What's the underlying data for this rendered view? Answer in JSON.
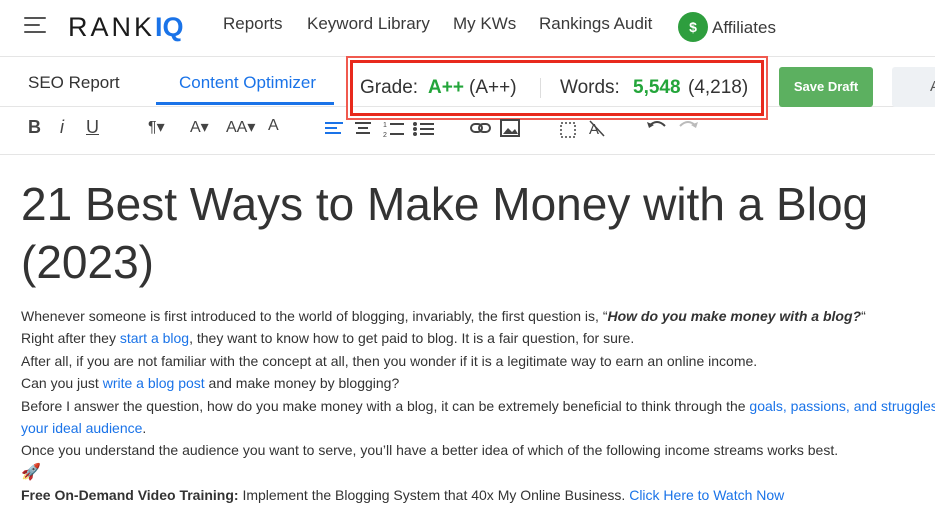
{
  "app": {
    "logo_main": "RANK",
    "logo_accent": "IQ",
    "nav": [
      "Reports",
      "Keyword Library",
      "My KWs",
      "Rankings Audit"
    ],
    "affiliates_label": "Affiliates",
    "affiliates_icon_glyph": "$"
  },
  "tabs": {
    "seo_report": "SEO Report",
    "content_optimizer": "Content Optimizer"
  },
  "metrics": {
    "grade_label": "Grade:",
    "grade_value": "A++",
    "grade_target": "(A++)",
    "words_label": "Words:",
    "words_value": "5,548",
    "words_target": "(4,218)"
  },
  "actions": {
    "save_draft": "Save Draft",
    "cutoff_button": "A"
  },
  "toolbar": {
    "bold": "B",
    "italic": "i",
    "underline": "U",
    "paragraph": "¶▾",
    "font": "A▾",
    "font_size": "AA▾",
    "color": "A"
  },
  "document": {
    "title_line1": "21 Best Ways to Make Money with a Blog",
    "title_line2": "(2023)",
    "p1_text": "Whenever someone is first introduced to the world of blogging, invariably, the first question is, “",
    "p1_bold": "How do you make money with a blog?",
    "p1_end": "“",
    "p2_start": "Right after they ",
    "p2_link": "start a blog",
    "p2_end": ", they want to know how to get paid to blog. It is a fair question, for sure.",
    "p3": "After all, if you are not familiar with the concept at all, then you wonder if it is a legitimate way to earn an online income.",
    "p4_start": "Can you just ",
    "p4_link": "write a blog post",
    "p4_end": " and make money by blogging?",
    "p5_start": "Before I answer the question, how do you make money with a blog, it can be extremely beneficial to think through the ",
    "p5_link": "goals, passions, and struggles",
    "p5_link2": "your ideal audience",
    "p5_end": ".",
    "p6": "Once you understand the audience you want to serve, you’ll have a better idea of which of the following income streams works best.",
    "rocket": "🚀",
    "p7_bold": "Free On-Demand Video Training:",
    "p7_text": " Implement the Blogging System that 40x My Online Business. ",
    "p7_link": "Click Here to Watch Now"
  }
}
